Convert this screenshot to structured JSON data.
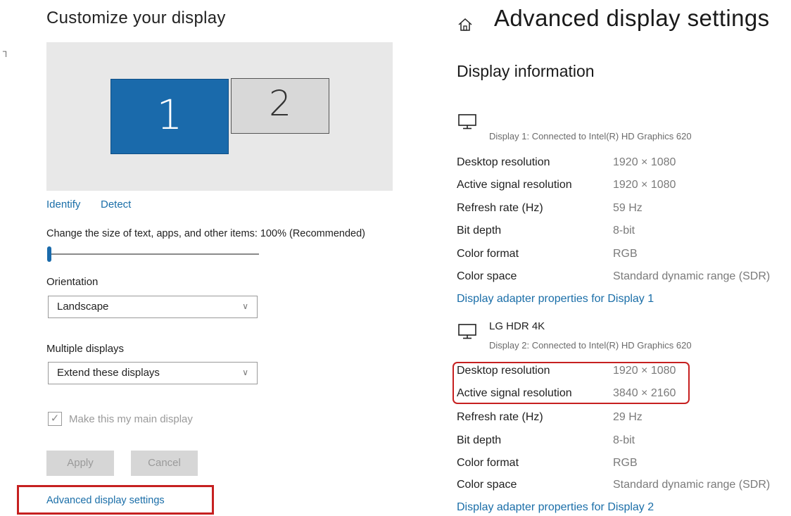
{
  "left": {
    "title": "Customize your display",
    "edge_icon": "restore-icon",
    "monitors": [
      "1",
      "2"
    ],
    "identify_label": "Identify",
    "detect_label": "Detect",
    "scale_label": "Change the size of text, apps, and other items: 100% (Recommended)",
    "scale_value_fraction": 0.0,
    "orientation_label": "Orientation",
    "orientation_value": "Landscape",
    "multiple_displays_label": "Multiple displays",
    "multiple_displays_value": "Extend these displays",
    "main_display_label": "Make this my main display",
    "main_display_checked": true,
    "apply_label": "Apply",
    "cancel_label": "Cancel",
    "advanced_link": "Advanced display settings"
  },
  "right": {
    "title": "Advanced display settings",
    "section_heading": "Display information",
    "displays": [
      {
        "name": "",
        "connection": "Display 1: Connected to Intel(R) HD Graphics 620",
        "rows": [
          {
            "label": "Desktop resolution",
            "value": "1920 × 1080"
          },
          {
            "label": "Active signal resolution",
            "value": "1920 × 1080"
          },
          {
            "label": "Refresh rate (Hz)",
            "value": "59 Hz"
          },
          {
            "label": "Bit depth",
            "value": "8-bit"
          },
          {
            "label": "Color format",
            "value": "RGB"
          },
          {
            "label": "Color space",
            "value": "Standard dynamic range (SDR)"
          }
        ],
        "adapter_link": "Display adapter properties for Display 1"
      },
      {
        "name": "LG HDR 4K",
        "connection": "Display 2: Connected to Intel(R) HD Graphics 620",
        "rows": [
          {
            "label": "Desktop resolution",
            "value": "1920 × 1080"
          },
          {
            "label": "Active signal resolution",
            "value": "3840 × 2160"
          },
          {
            "label": "Refresh rate (Hz)",
            "value": "29 Hz"
          },
          {
            "label": "Bit depth",
            "value": "8-bit"
          },
          {
            "label": "Color format",
            "value": "RGB"
          },
          {
            "label": "Color space",
            "value": "Standard dynamic range (SDR)"
          }
        ],
        "adapter_link": "Display adapter properties for Display 2"
      }
    ]
  },
  "colors": {
    "accent": "#1a6aab",
    "link": "#1a6ea8",
    "highlight": "#c62020"
  }
}
